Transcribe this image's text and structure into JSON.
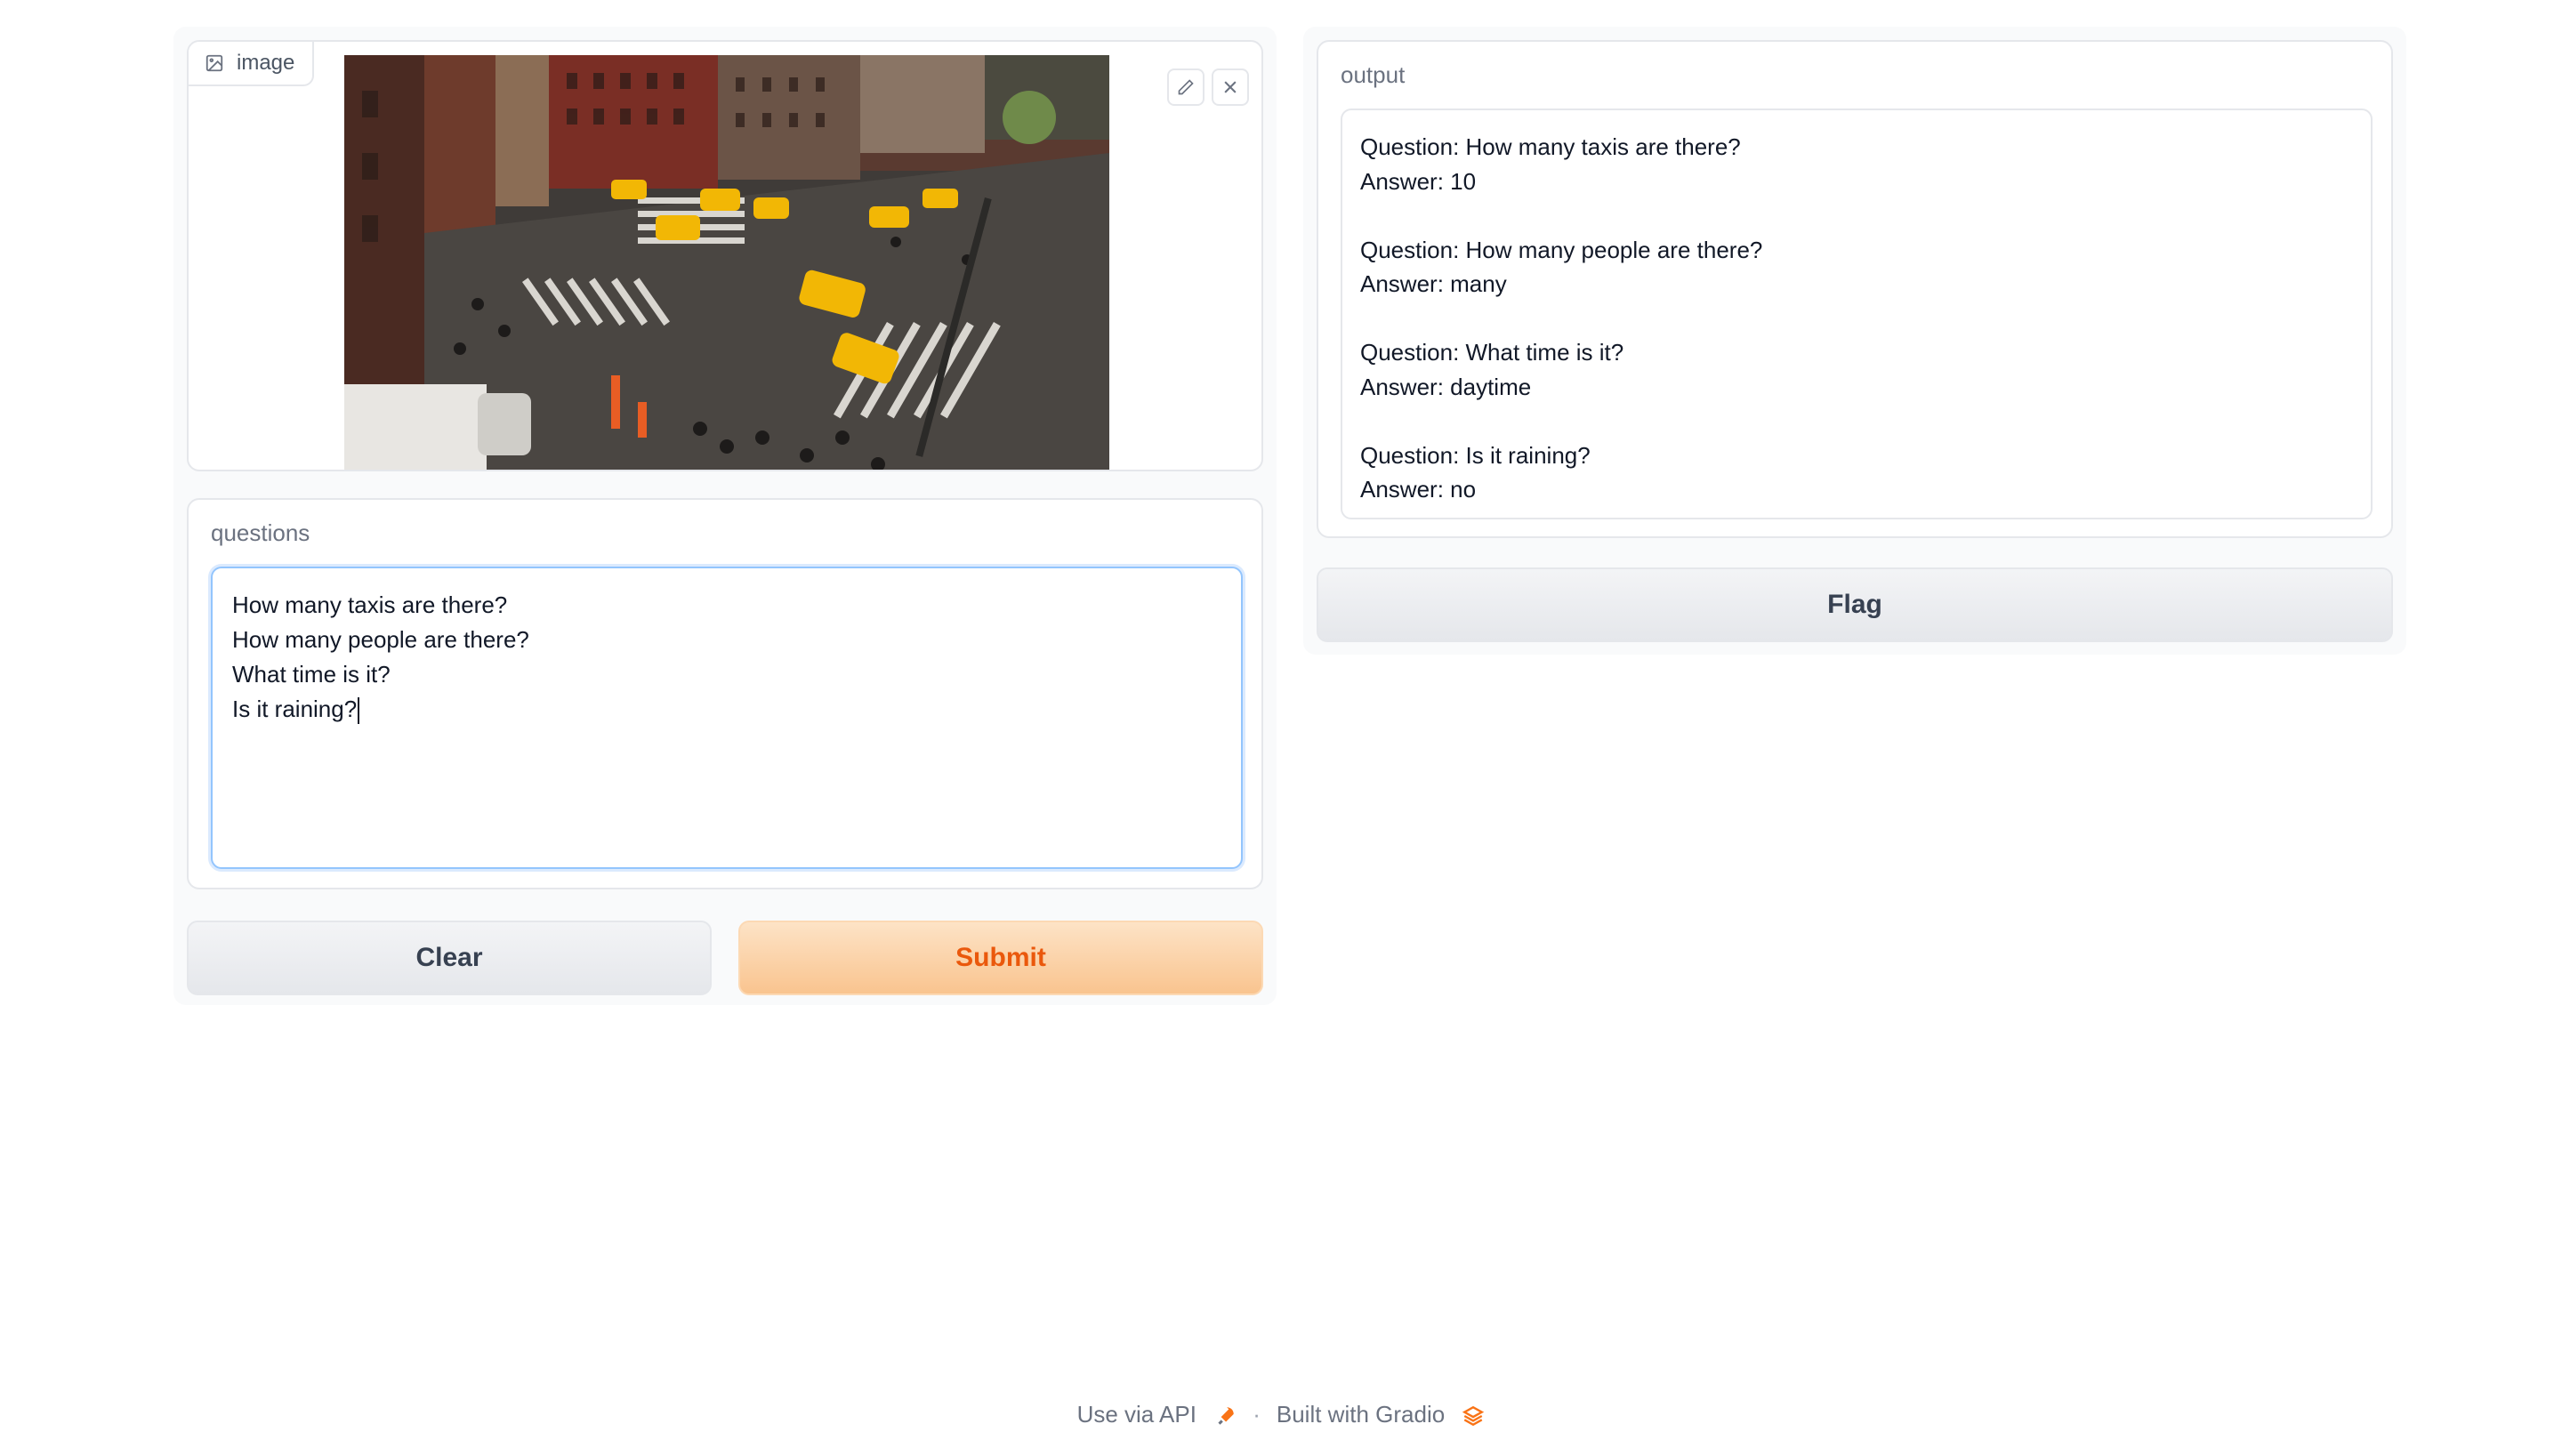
{
  "image_input": {
    "label": "image",
    "icon": "image-icon",
    "edit_icon": "pencil-icon",
    "close_icon": "close-icon"
  },
  "questions": {
    "label": "questions",
    "value": "How many taxis are there?\nHow many people are there?\nWhat time is it?\nIs it raining?"
  },
  "buttons": {
    "clear": "Clear",
    "submit": "Submit",
    "flag": "Flag"
  },
  "output": {
    "label": "output",
    "value": "Question: How many taxis are there?\nAnswer: 10\n\nQuestion: How many people are there?\nAnswer: many\n\nQuestion: What time is it?\nAnswer: daytime\n\nQuestion: Is it raining?\nAnswer: no"
  },
  "footer": {
    "api_link": "Use via API",
    "separator": "·",
    "built_with": "Built with Gradio"
  },
  "colors": {
    "accent": "#ea580c",
    "submit_bg": "#fbd3a8",
    "focus_border": "#93c5fd"
  }
}
